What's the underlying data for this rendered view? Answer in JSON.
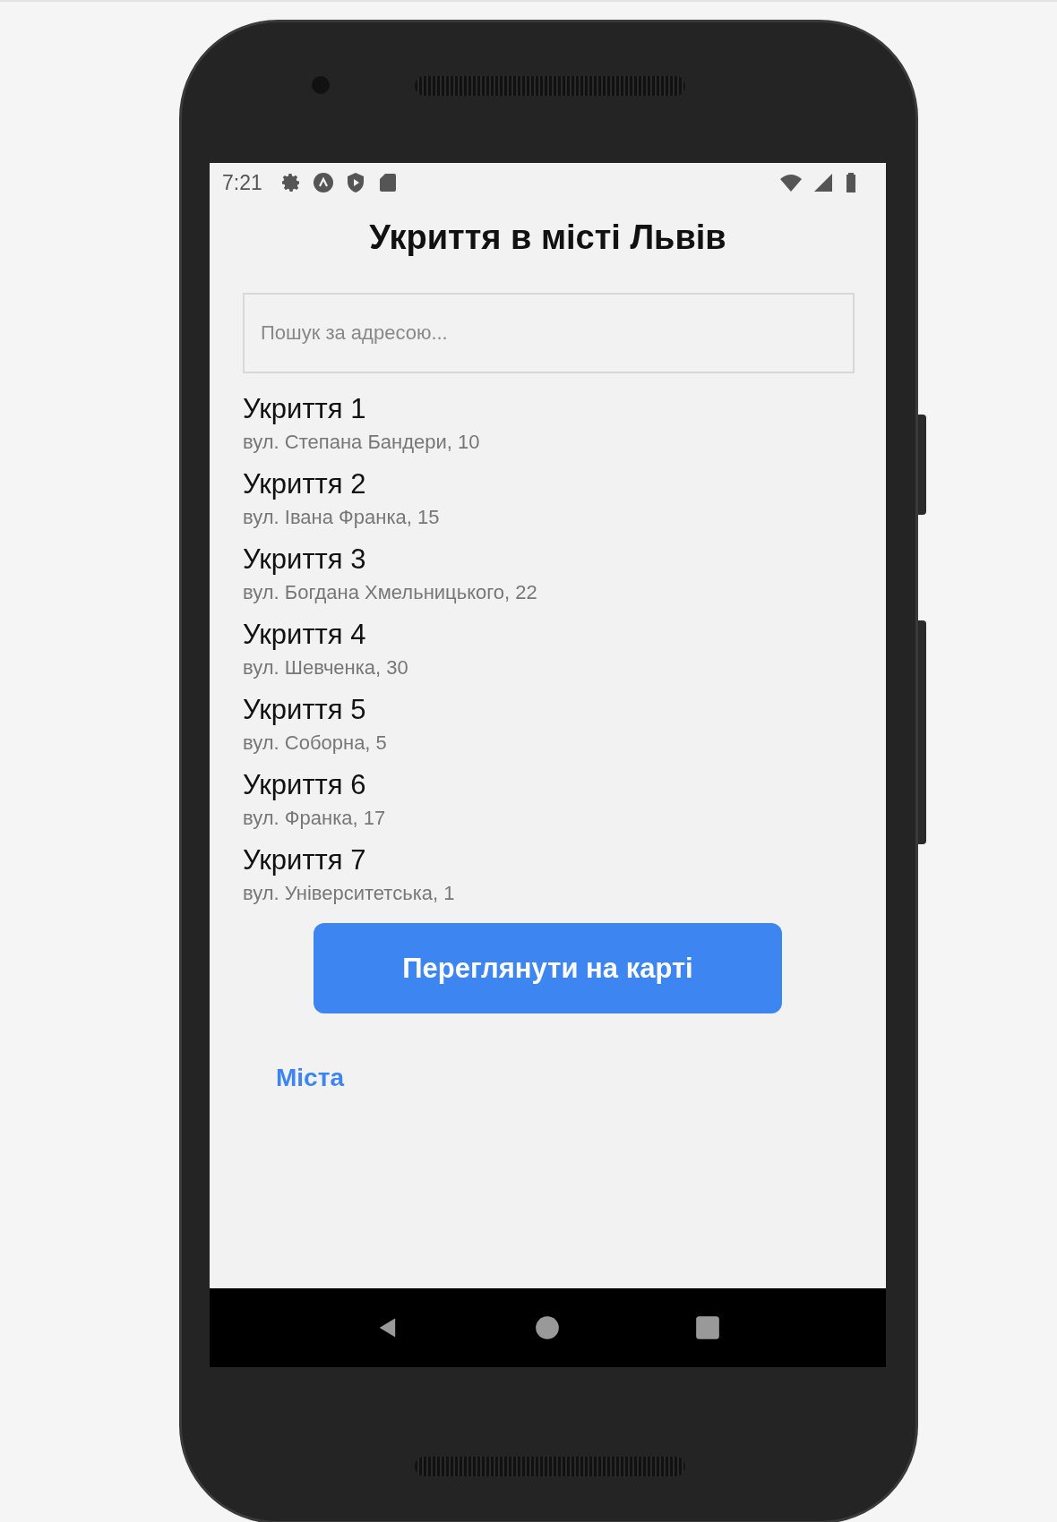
{
  "status_bar": {
    "time": "7:21"
  },
  "title": "Укриття в місті Львів",
  "search": {
    "placeholder": "Пошук за адресою..."
  },
  "shelters": [
    {
      "name": "Укриття 1",
      "address": "вул. Степана Бандери, 10"
    },
    {
      "name": "Укриття 2",
      "address": "вул. Івана Франка, 15"
    },
    {
      "name": "Укриття 3",
      "address": "вул. Богдана Хмельницького, 22"
    },
    {
      "name": "Укриття 4",
      "address": "вул. Шевченка, 30"
    },
    {
      "name": "Укриття 5",
      "address": "вул. Соборна, 5"
    },
    {
      "name": "Укриття 6",
      "address": "вул. Франка, 17"
    },
    {
      "name": "Укриття 7",
      "address": "вул. Університетська, 1"
    }
  ],
  "map_button": "Переглянути на карті",
  "cities_link": "Міста"
}
